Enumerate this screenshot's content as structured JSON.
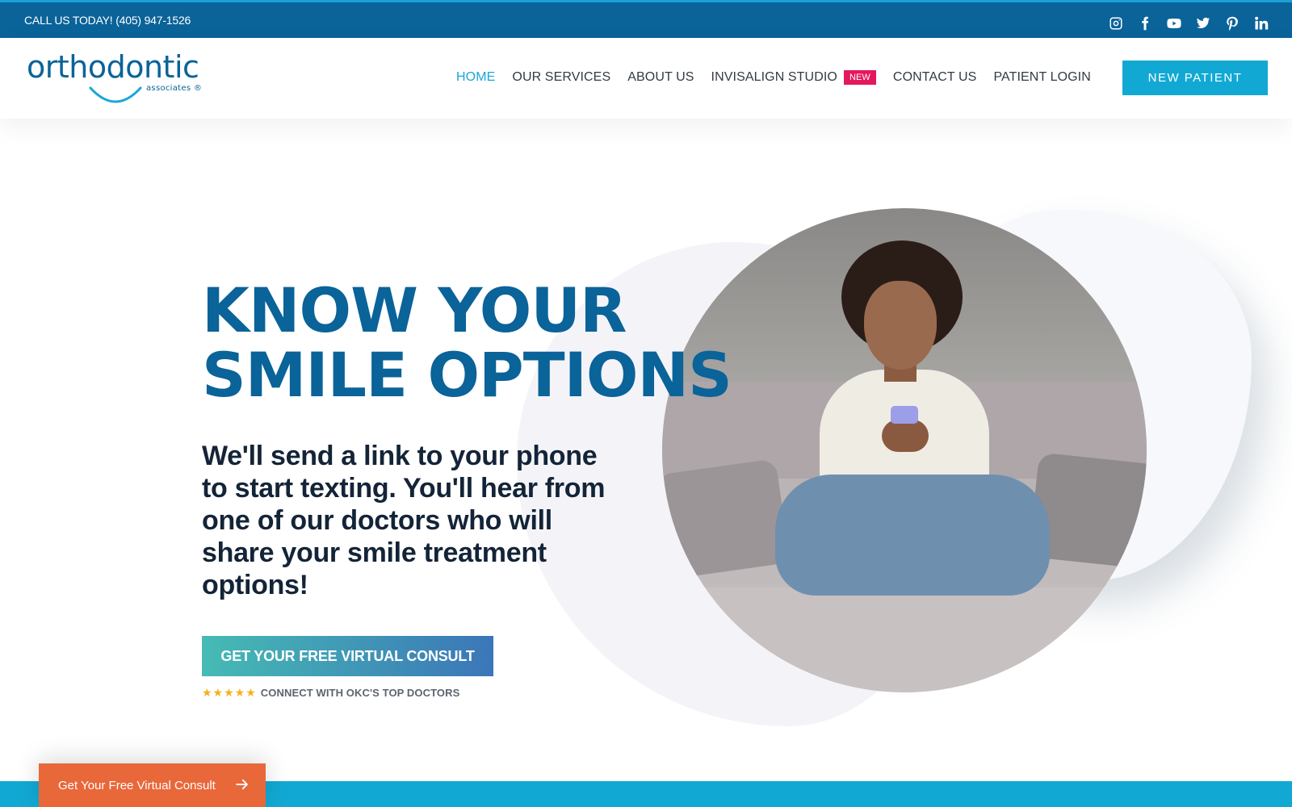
{
  "topbar": {
    "phone_text": "CALL US TODAY! (405) 947-1526",
    "socials": [
      "instagram-icon",
      "facebook-icon",
      "youtube-icon",
      "twitter-icon",
      "pinterest-icon",
      "linkedin-icon"
    ]
  },
  "header": {
    "logo_word": "orthodontic",
    "logo_sub": "associates ®",
    "nav": [
      {
        "label": "HOME",
        "active": true
      },
      {
        "label": "OUR SERVICES"
      },
      {
        "label": "ABOUT US"
      },
      {
        "label": "INVISALIGN STUDIO",
        "badge": "NEW"
      },
      {
        "label": "CONTACT US"
      },
      {
        "label": "PATIENT LOGIN"
      }
    ],
    "new_patient_label": "NEW PATIENT"
  },
  "hero": {
    "headline_line1": "KNOW YOUR",
    "headline_line2": "SMILE OPTIONS",
    "subtext": "We'll send a link to your phone to start texting. You'll hear from one of our doctors who will share your smile treatment options!",
    "cta_label": "GET YOUR FREE VIRTUAL CONSULT",
    "rating_stars": "★★★★★",
    "rating_text": "CONNECT WITH OKC'S TOP DOCTORS"
  },
  "floating": {
    "label": "Get Your Free Virtual Consult"
  },
  "colors": {
    "brand_blue": "#0a6399",
    "accent_cyan": "#11a9d4",
    "badge_pink": "#e4185e",
    "float_orange": "#e8683a"
  }
}
